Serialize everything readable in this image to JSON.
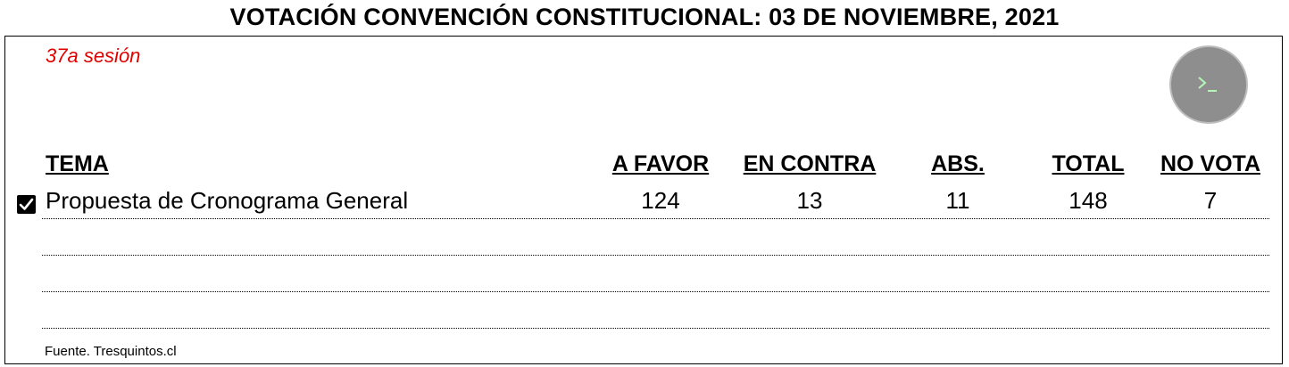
{
  "title": "VOTACIÓN CONVENCIÓN CONSTITUCIONAL: 03 DE NOVIEMBRE, 2021",
  "session": "37a sesión",
  "terminal_icon": "terminal-icon",
  "columns": {
    "tema": "TEMA",
    "a_favor": "A FAVOR",
    "en_contra": "EN CONTRA",
    "abs": "ABS.",
    "total": "TOTAL",
    "no_vota": "NO VOTA"
  },
  "rows": [
    {
      "checked": true,
      "tema": "Propuesta de Cronograma General",
      "a_favor": "124",
      "en_contra": "13",
      "abs": "11",
      "total": "148",
      "no_vota": "7"
    }
  ],
  "source": "Fuente. Tresquintos.cl",
  "colors": {
    "session": "#e00000",
    "terminal_button": "#8e8e8e",
    "terminal_prompt": "#b7f5b7"
  }
}
